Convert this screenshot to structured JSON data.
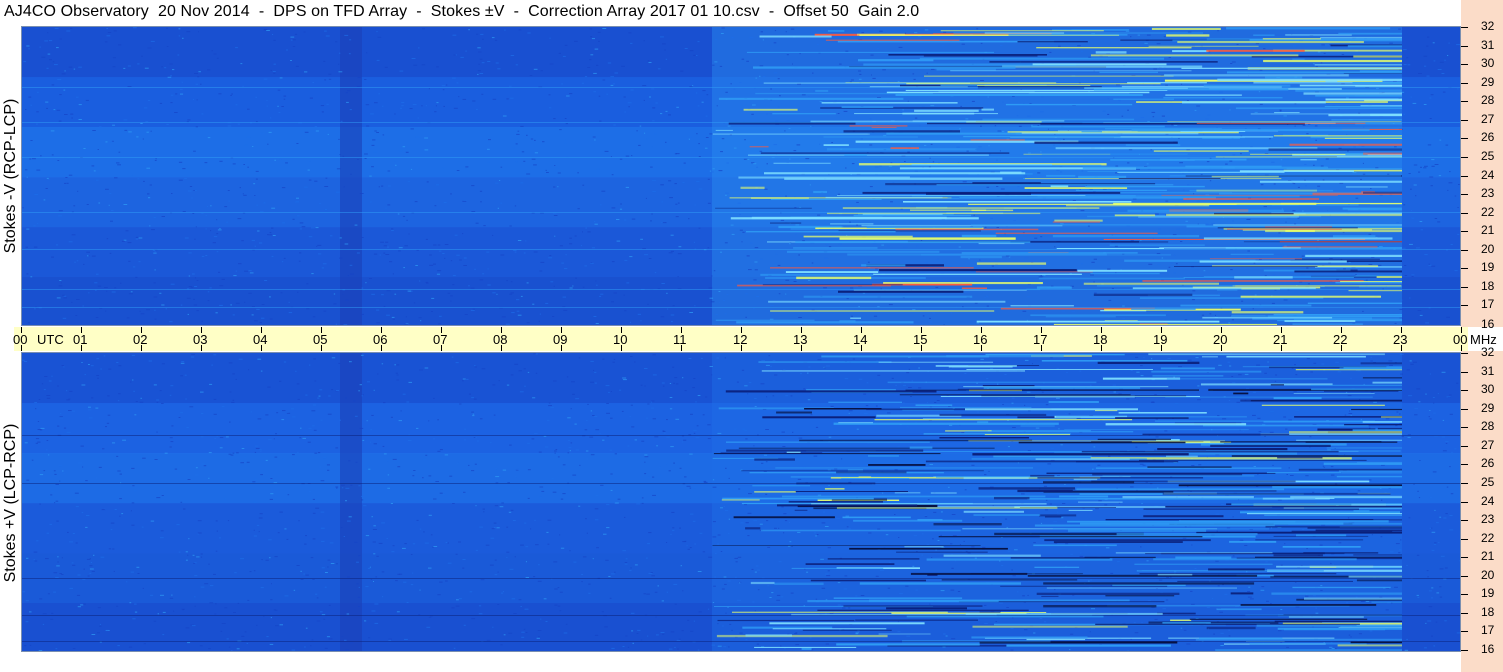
{
  "header": {
    "title": "AJ4CO Observatory  20 Nov 2014  -  DPS on TFD Array  -  Stokes ±V  -  Correction Array 2017 01 10.csv  -  Offset 50  Gain 2.0"
  },
  "chart_data": [
    {
      "type": "heatmap",
      "panel": "top",
      "ylabel": "Stokes -V (RCP-LCP)",
      "y_ticks": [
        "32",
        "31",
        "30",
        "29",
        "28",
        "27",
        "26",
        "25",
        "24",
        "23",
        "22",
        "21",
        "20",
        "19",
        "18",
        "17",
        "16"
      ],
      "ylim": [
        16,
        32
      ],
      "y_unit": "MHz",
      "x_ticks": [
        "00",
        "01",
        "02",
        "03",
        "04",
        "05",
        "06",
        "07",
        "08",
        "09",
        "10",
        "11",
        "12",
        "13",
        "14",
        "15",
        "16",
        "17",
        "18",
        "19",
        "20",
        "21",
        "22",
        "23",
        "00"
      ],
      "x_unit": "UTC",
      "colormap": [
        "#0a1f7a",
        "#1545c8",
        "#1e6ee8",
        "#2f9cf5",
        "#7fe0ff",
        "#e8ff6a",
        "#ff5a3c"
      ],
      "active_period_utc": [
        11.5,
        23.0
      ]
    },
    {
      "type": "heatmap",
      "panel": "bottom",
      "ylabel": "Stokes +V (LCP-RCP)",
      "y_ticks": [
        "32",
        "31",
        "30",
        "29",
        "28",
        "27",
        "26",
        "25",
        "24",
        "23",
        "22",
        "21",
        "20",
        "19",
        "18",
        "17",
        "16"
      ],
      "ylim": [
        16,
        32
      ],
      "y_unit": "MHz",
      "x_ticks": [
        "00",
        "01",
        "02",
        "03",
        "04",
        "05",
        "06",
        "07",
        "08",
        "09",
        "10",
        "11",
        "12",
        "13",
        "14",
        "15",
        "16",
        "17",
        "18",
        "19",
        "20",
        "21",
        "22",
        "23",
        "00"
      ],
      "x_unit": "UTC",
      "colormap": [
        "#0a1f7a",
        "#1545c8",
        "#1e6ee8",
        "#2f9cf5",
        "#7fe0ff",
        "#e8ff6a",
        "#ff5a3c"
      ],
      "active_period_utc": [
        11.5,
        23.0
      ]
    }
  ],
  "axis": {
    "utc_label": "UTC",
    "mhz_label": "MHz"
  }
}
